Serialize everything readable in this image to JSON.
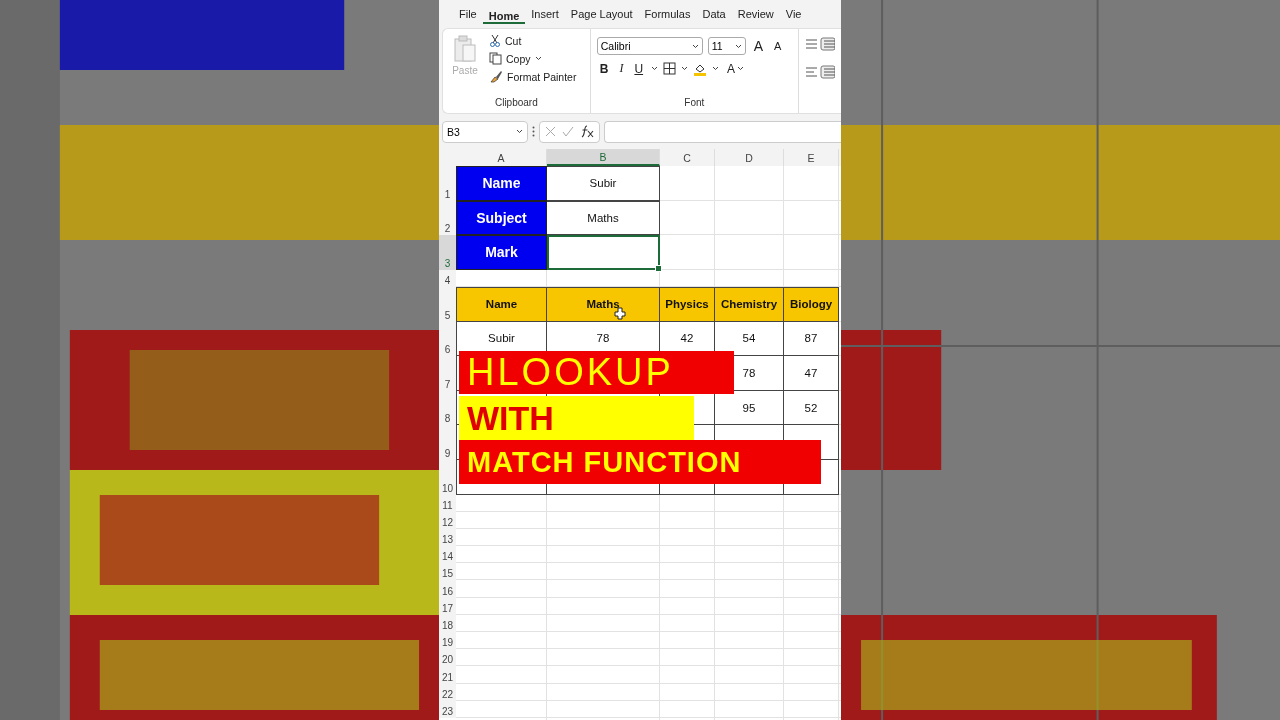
{
  "menu_tabs": [
    {
      "label": "File",
      "selected": false
    },
    {
      "label": "Home",
      "selected": true
    },
    {
      "label": "Insert",
      "selected": false
    },
    {
      "label": "Page Layout",
      "selected": false
    },
    {
      "label": "Formulas",
      "selected": false
    },
    {
      "label": "Data",
      "selected": false
    },
    {
      "label": "Review",
      "selected": false
    },
    {
      "label": "Vie",
      "selected": false
    }
  ],
  "clipboard": {
    "paste": {
      "label": "Paste",
      "disabled": true
    },
    "actions": [
      "Cut",
      "Copy",
      "Format Painter"
    ],
    "group_label": "Clipboard"
  },
  "font": {
    "family": "Calibri",
    "size": "11",
    "grow": "A",
    "shrink": "A",
    "styles": [
      "B",
      "I",
      "U"
    ],
    "font_color": "A",
    "group_label": "Font"
  },
  "formula_bar": {
    "name_box": "B3"
  },
  "columns": [
    {
      "label": "A",
      "selected": false
    },
    {
      "label": "B",
      "selected": true
    },
    {
      "label": "C",
      "selected": false
    },
    {
      "label": "D",
      "selected": false
    },
    {
      "label": "E",
      "selected": false
    }
  ],
  "rows": [
    {
      "number": "1",
      "selected": false,
      "cells": [
        {
          "kind": "label",
          "text": "Name"
        },
        {
          "kind": "value",
          "text": "Subir"
        }
      ]
    },
    {
      "number": "2",
      "selected": false,
      "cells": [
        {
          "kind": "label",
          "text": "Subject"
        },
        {
          "kind": "value",
          "text": "Maths"
        }
      ]
    },
    {
      "number": "3",
      "selected": true,
      "cells": [
        {
          "kind": "label",
          "text": "Mark"
        },
        {
          "kind": "active"
        }
      ]
    },
    {
      "number": "4",
      "selected": false,
      "cells": []
    },
    {
      "number": "5",
      "selected": false,
      "cells": [
        {
          "kind": "header",
          "text": "Name"
        },
        {
          "kind": "header",
          "text": "Maths"
        },
        {
          "kind": "header",
          "text": "Physics"
        },
        {
          "kind": "header",
          "text": "Chemistry"
        },
        {
          "kind": "header",
          "text": "Biology"
        }
      ]
    },
    {
      "number": "6",
      "selected": false,
      "cells": [
        {
          "kind": "data",
          "text": "Subir"
        },
        {
          "kind": "data",
          "text": "78"
        },
        {
          "kind": "data",
          "text": "42"
        },
        {
          "kind": "data",
          "text": "54"
        },
        {
          "kind": "data",
          "text": "87"
        }
      ]
    },
    {
      "number": "7",
      "selected": false,
      "cells": [
        {
          "kind": "data"
        },
        {
          "kind": "covered"
        },
        {
          "kind": "covered"
        },
        {
          "kind": "data",
          "text": "78"
        },
        {
          "kind": "data",
          "text": "47"
        }
      ]
    },
    {
      "number": "8",
      "selected": false,
      "cells": [
        {
          "kind": "data"
        },
        {
          "kind": "data"
        },
        {
          "kind": "data"
        },
        {
          "kind": "data",
          "text": "95"
        },
        {
          "kind": "data",
          "text": "52"
        }
      ]
    },
    {
      "number": "9",
      "selected": false,
      "cells": [
        {
          "kind": "data"
        },
        {
          "kind": "covered"
        },
        {
          "kind": "data"
        },
        {
          "kind": "data"
        },
        {
          "kind": "data"
        }
      ]
    },
    {
      "number": "10",
      "selected": false,
      "cells": [
        {
          "kind": "data"
        },
        {
          "kind": "data"
        },
        {
          "kind": "data"
        },
        {
          "kind": "data"
        },
        {
          "kind": "data"
        }
      ]
    },
    {
      "number": "11",
      "selected": false,
      "cells": []
    },
    {
      "number": "12",
      "selected": false,
      "cells": []
    },
    {
      "number": "13",
      "selected": false,
      "cells": []
    },
    {
      "number": "14",
      "selected": false,
      "cells": []
    },
    {
      "number": "15",
      "selected": false,
      "cells": []
    },
    {
      "number": "16",
      "selected": false,
      "cells": []
    },
    {
      "number": "17",
      "selected": false,
      "cells": []
    },
    {
      "number": "18",
      "selected": false,
      "cells": []
    },
    {
      "number": "19",
      "selected": false,
      "cells": []
    },
    {
      "number": "20",
      "selected": false,
      "cells": []
    },
    {
      "number": "21",
      "selected": false,
      "cells": []
    },
    {
      "number": "22",
      "selected": false,
      "cells": []
    },
    {
      "number": "23",
      "selected": false,
      "cells": []
    }
  ],
  "title_overlay": [
    {
      "text": "HLOOKUP",
      "kind": "thin"
    },
    {
      "text": "WITH",
      "kind": "yellow"
    },
    {
      "text": "MATCH FUNCTION",
      "kind": "bold"
    }
  ]
}
